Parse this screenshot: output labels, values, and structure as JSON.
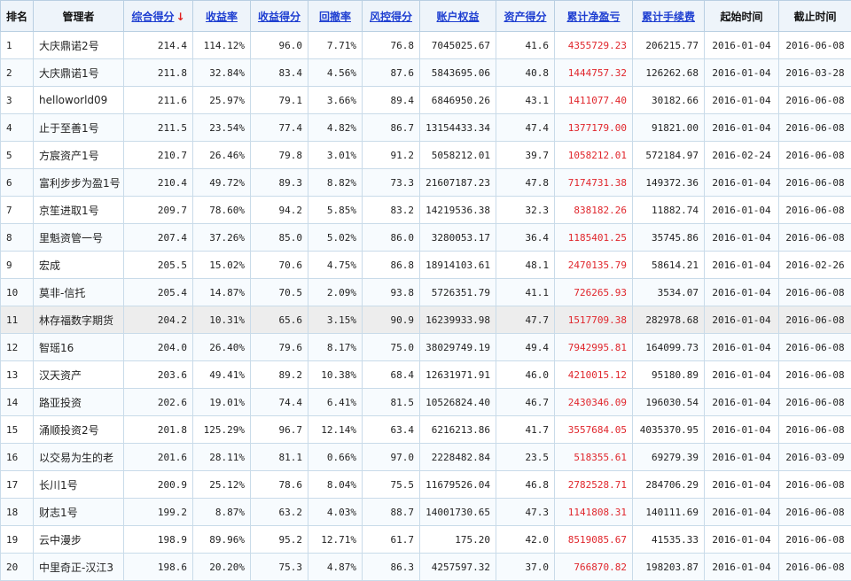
{
  "headers": [
    {
      "label": "排名",
      "link": false
    },
    {
      "label": "管理者",
      "link": false
    },
    {
      "label": "综合得分",
      "link": true,
      "sorted": true,
      "arrow": "↓"
    },
    {
      "label": "收益率",
      "link": true
    },
    {
      "label": "收益得分",
      "link": true
    },
    {
      "label": "回撤率",
      "link": true
    },
    {
      "label": "风控得分",
      "link": true
    },
    {
      "label": "账户权益",
      "link": true
    },
    {
      "label": "资产得分",
      "link": true
    },
    {
      "label": "累计净盈亏",
      "link": true
    },
    {
      "label": "累计手续费",
      "link": true
    },
    {
      "label": "起始时间",
      "link": false
    },
    {
      "label": "截止时间",
      "link": false
    }
  ],
  "rows": [
    {
      "rank": "1",
      "name": "大庆鼎诺2号",
      "score": "214.4",
      "ret": "114.12%",
      "ret_score": "96.0",
      "dd": "7.71%",
      "risk": "76.8",
      "equity": "7045025.67",
      "asset": "41.6",
      "pnl": "4355729.23",
      "fee": "206215.77",
      "start": "2016-01-04",
      "end": "2016-06-08"
    },
    {
      "rank": "2",
      "name": "大庆鼎诺1号",
      "score": "211.8",
      "ret": "32.84%",
      "ret_score": "83.4",
      "dd": "4.56%",
      "risk": "87.6",
      "equity": "5843695.06",
      "asset": "40.8",
      "pnl": "1444757.32",
      "fee": "126262.68",
      "start": "2016-01-04",
      "end": "2016-03-28"
    },
    {
      "rank": "3",
      "name": "helloworld09",
      "score": "211.6",
      "ret": "25.97%",
      "ret_score": "79.1",
      "dd": "3.66%",
      "risk": "89.4",
      "equity": "6846950.26",
      "asset": "43.1",
      "pnl": "1411077.40",
      "fee": "30182.66",
      "start": "2016-01-04",
      "end": "2016-06-08"
    },
    {
      "rank": "4",
      "name": "止于至善1号",
      "score": "211.5",
      "ret": "23.54%",
      "ret_score": "77.4",
      "dd": "4.82%",
      "risk": "86.7",
      "equity": "13154433.34",
      "asset": "47.4",
      "pnl": "1377179.00",
      "fee": "91821.00",
      "start": "2016-01-04",
      "end": "2016-06-08"
    },
    {
      "rank": "5",
      "name": "方宸资产1号",
      "score": "210.7",
      "ret": "26.46%",
      "ret_score": "79.8",
      "dd": "3.01%",
      "risk": "91.2",
      "equity": "5058212.01",
      "asset": "39.7",
      "pnl": "1058212.01",
      "fee": "572184.97",
      "start": "2016-02-24",
      "end": "2016-06-08"
    },
    {
      "rank": "6",
      "name": "富利步步为盈1号",
      "score": "210.4",
      "ret": "49.72%",
      "ret_score": "89.3",
      "dd": "8.82%",
      "risk": "73.3",
      "equity": "21607187.23",
      "asset": "47.8",
      "pnl": "7174731.38",
      "fee": "149372.36",
      "start": "2016-01-04",
      "end": "2016-06-08"
    },
    {
      "rank": "7",
      "name": "京笙进取1号",
      "score": "209.7",
      "ret": "78.60%",
      "ret_score": "94.2",
      "dd": "5.85%",
      "risk": "83.2",
      "equity": "14219536.38",
      "asset": "32.3",
      "pnl": "838182.26",
      "fee": "11882.74",
      "start": "2016-01-04",
      "end": "2016-06-08"
    },
    {
      "rank": "8",
      "name": "里魁资管一号",
      "score": "207.4",
      "ret": "37.26%",
      "ret_score": "85.0",
      "dd": "5.02%",
      "risk": "86.0",
      "equity": "3280053.17",
      "asset": "36.4",
      "pnl": "1185401.25",
      "fee": "35745.86",
      "start": "2016-01-04",
      "end": "2016-06-08"
    },
    {
      "rank": "9",
      "name": "宏成",
      "score": "205.5",
      "ret": "15.02%",
      "ret_score": "70.6",
      "dd": "4.75%",
      "risk": "86.8",
      "equity": "18914103.61",
      "asset": "48.1",
      "pnl": "2470135.79",
      "fee": "58614.21",
      "start": "2016-01-04",
      "end": "2016-02-26"
    },
    {
      "rank": "10",
      "name": "莫非-信托",
      "score": "205.4",
      "ret": "14.87%",
      "ret_score": "70.5",
      "dd": "2.09%",
      "risk": "93.8",
      "equity": "5726351.79",
      "asset": "41.1",
      "pnl": "726265.93",
      "fee": "3534.07",
      "start": "2016-01-04",
      "end": "2016-06-08"
    },
    {
      "rank": "11",
      "name": "林存福数字期货",
      "score": "204.2",
      "ret": "10.31%",
      "ret_score": "65.6",
      "dd": "3.15%",
      "risk": "90.9",
      "equity": "16239933.98",
      "asset": "47.7",
      "pnl": "1517709.38",
      "fee": "282978.68",
      "start": "2016-01-04",
      "end": "2016-06-08",
      "highlight": true
    },
    {
      "rank": "12",
      "name": "智瑶16",
      "score": "204.0",
      "ret": "26.40%",
      "ret_score": "79.6",
      "dd": "8.17%",
      "risk": "75.0",
      "equity": "38029749.19",
      "asset": "49.4",
      "pnl": "7942995.81",
      "fee": "164099.73",
      "start": "2016-01-04",
      "end": "2016-06-08"
    },
    {
      "rank": "13",
      "name": "汉天资产",
      "score": "203.6",
      "ret": "49.41%",
      "ret_score": "89.2",
      "dd": "10.38%",
      "risk": "68.4",
      "equity": "12631971.91",
      "asset": "46.0",
      "pnl": "4210015.12",
      "fee": "95180.89",
      "start": "2016-01-04",
      "end": "2016-06-08"
    },
    {
      "rank": "14",
      "name": "路亚投资",
      "score": "202.6",
      "ret": "19.01%",
      "ret_score": "74.4",
      "dd": "6.41%",
      "risk": "81.5",
      "equity": "10526824.40",
      "asset": "46.7",
      "pnl": "2430346.09",
      "fee": "196030.54",
      "start": "2016-01-04",
      "end": "2016-06-08"
    },
    {
      "rank": "15",
      "name": "涌顺投资2号",
      "score": "201.8",
      "ret": "125.29%",
      "ret_score": "96.7",
      "dd": "12.14%",
      "risk": "63.4",
      "equity": "6216213.86",
      "asset": "41.7",
      "pnl": "3557684.05",
      "fee": "4035370.95",
      "start": "2016-01-04",
      "end": "2016-06-08"
    },
    {
      "rank": "16",
      "name": "以交易为生的老",
      "score": "201.6",
      "ret": "28.11%",
      "ret_score": "81.1",
      "dd": "0.66%",
      "risk": "97.0",
      "equity": "2228482.84",
      "asset": "23.5",
      "pnl": "518355.61",
      "fee": "69279.39",
      "start": "2016-01-04",
      "end": "2016-03-09"
    },
    {
      "rank": "17",
      "name": "长川1号",
      "score": "200.9",
      "ret": "25.12%",
      "ret_score": "78.6",
      "dd": "8.04%",
      "risk": "75.5",
      "equity": "11679526.04",
      "asset": "46.8",
      "pnl": "2782528.71",
      "fee": "284706.29",
      "start": "2016-01-04",
      "end": "2016-06-08"
    },
    {
      "rank": "18",
      "name": "财志1号",
      "score": "199.2",
      "ret": "8.87%",
      "ret_score": "63.2",
      "dd": "4.03%",
      "risk": "88.7",
      "equity": "14001730.65",
      "asset": "47.3",
      "pnl": "1141808.31",
      "fee": "140111.69",
      "start": "2016-01-04",
      "end": "2016-06-08"
    },
    {
      "rank": "19",
      "name": "云中漫步",
      "score": "198.9",
      "ret": "89.96%",
      "ret_score": "95.2",
      "dd": "12.71%",
      "risk": "61.7",
      "equity": "175.20",
      "asset": "42.0",
      "pnl": "8519085.67",
      "fee": "41535.33",
      "start": "2016-01-04",
      "end": "2016-06-08"
    },
    {
      "rank": "20",
      "name": "中里奇正-汉江3",
      "score": "198.6",
      "ret": "20.20%",
      "ret_score": "75.3",
      "dd": "4.87%",
      "risk": "86.3",
      "equity": "4257597.32",
      "asset": "37.0",
      "pnl": "766870.82",
      "fee": "198203.87",
      "start": "2016-01-04",
      "end": "2016-06-08"
    }
  ],
  "colors": {
    "header_bg": "#eef4fa",
    "link": "#1f3fd1",
    "pnl": "#e0262c",
    "border": "#c9dbe9"
  }
}
